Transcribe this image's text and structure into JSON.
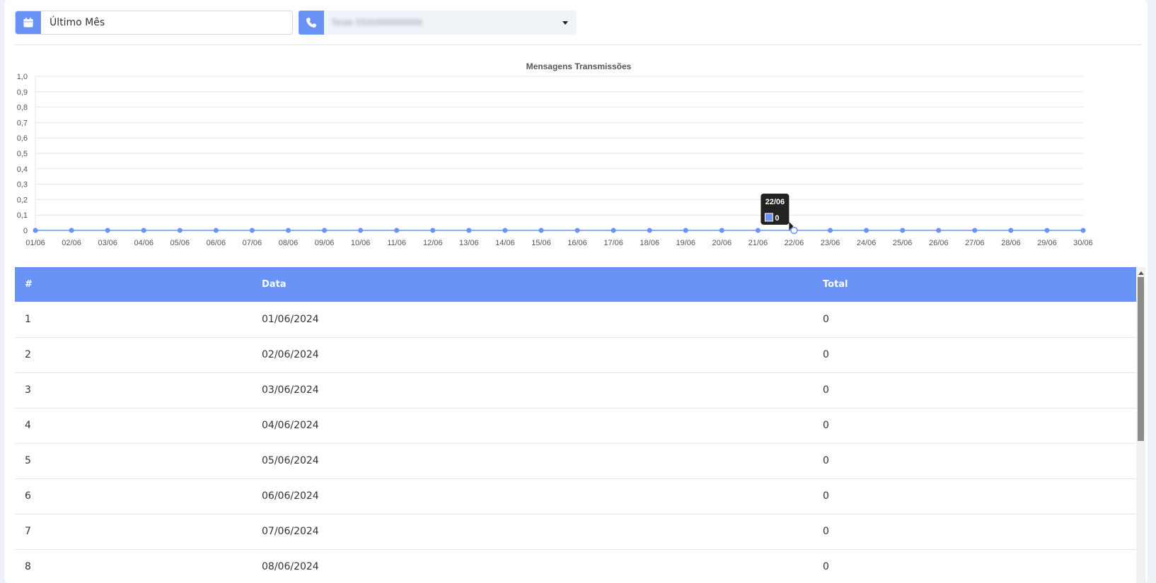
{
  "filters": {
    "period": {
      "value": "Último Mês",
      "icon": "calendar-icon"
    },
    "phone": {
      "value": "Teste 5500999999999",
      "icon": "phone-icon"
    }
  },
  "colors": {
    "accent": "#6a93f8",
    "tooltip_bg": "#222222"
  },
  "chart_data": {
    "type": "line",
    "title": "Mensagens Transmissões",
    "categories": [
      "01/06",
      "02/06",
      "03/06",
      "04/06",
      "05/06",
      "06/06",
      "07/06",
      "08/06",
      "09/06",
      "10/06",
      "11/06",
      "12/06",
      "13/06",
      "14/06",
      "15/06",
      "16/06",
      "17/06",
      "18/06",
      "19/06",
      "20/06",
      "21/06",
      "22/06",
      "23/06",
      "24/06",
      "25/06",
      "26/06",
      "27/06",
      "28/06",
      "29/06",
      "30/06"
    ],
    "series": [
      {
        "values": [
          0,
          0,
          0,
          0,
          0,
          0,
          0,
          0,
          0,
          0,
          0,
          0,
          0,
          0,
          0,
          0,
          0,
          0,
          0,
          0,
          0,
          0,
          0,
          0,
          0,
          0,
          0,
          0,
          0,
          0
        ]
      }
    ],
    "ylim": [
      0,
      1.0
    ],
    "yticks": [
      "0",
      "0,1",
      "0,2",
      "0,3",
      "0,4",
      "0,5",
      "0,6",
      "0,7",
      "0,8",
      "0,9",
      "1,0"
    ],
    "grid": true,
    "tooltip": {
      "category": "22/06",
      "value": "0"
    }
  },
  "table": {
    "headers": [
      "#",
      "Data",
      "Total"
    ],
    "rows": [
      [
        "1",
        "01/06/2024",
        "0"
      ],
      [
        "2",
        "02/06/2024",
        "0"
      ],
      [
        "3",
        "03/06/2024",
        "0"
      ],
      [
        "4",
        "04/06/2024",
        "0"
      ],
      [
        "5",
        "05/06/2024",
        "0"
      ],
      [
        "6",
        "06/06/2024",
        "0"
      ],
      [
        "7",
        "07/06/2024",
        "0"
      ],
      [
        "8",
        "08/06/2024",
        "0"
      ]
    ]
  }
}
